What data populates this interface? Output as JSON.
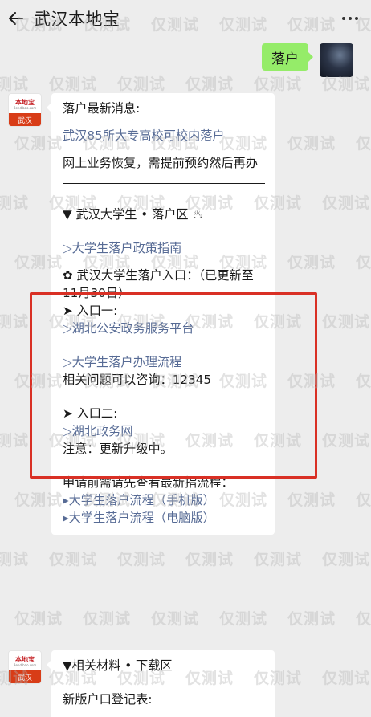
{
  "header": {
    "title": "武汉本地宝"
  },
  "outgoing": {
    "text": "落户"
  },
  "bot": {
    "brand": "本地宝",
    "url": "Bendibao.com",
    "city": "武汉"
  },
  "message1": {
    "heading": "落户最新消息:",
    "link_campus": "武汉85所大专高校可校内落户",
    "notice": "网上业务恢复，需提前预约然后再办",
    "section1_title": "▼ 武汉大学生 • 落户区 ♨",
    "link_policy": "▷大学生落户政策指南",
    "entry_info": "✿ 武汉大学生落户入口：（已更新至11月30日）",
    "entry1_label": "➤ 入口一:",
    "link_entry1": "▷湖北公安政务服务平台",
    "link_process": "▷大学生落户办理流程",
    "consult": "相关问题可以咨询：12345",
    "entry2_label": "➤ 入口二:",
    "link_entry2": "▷湖北政务网",
    "note": "注意：更新升级中。",
    "apply_tip": "申请前需请先查看最新指流程：",
    "link_mobile": "▸大学生落户流程（手机版）",
    "link_pc": "▸大学生落户流程（电脑版）"
  },
  "message2": {
    "section_title": "▼相关材料 • 下载区",
    "item1": "新版户口登记表:"
  },
  "watermark": {
    "text": "仅测试"
  },
  "colors": {
    "link": "#576b95",
    "bubble_me": "#95ec69",
    "highlight": "#d93025",
    "background": "#ededed"
  }
}
